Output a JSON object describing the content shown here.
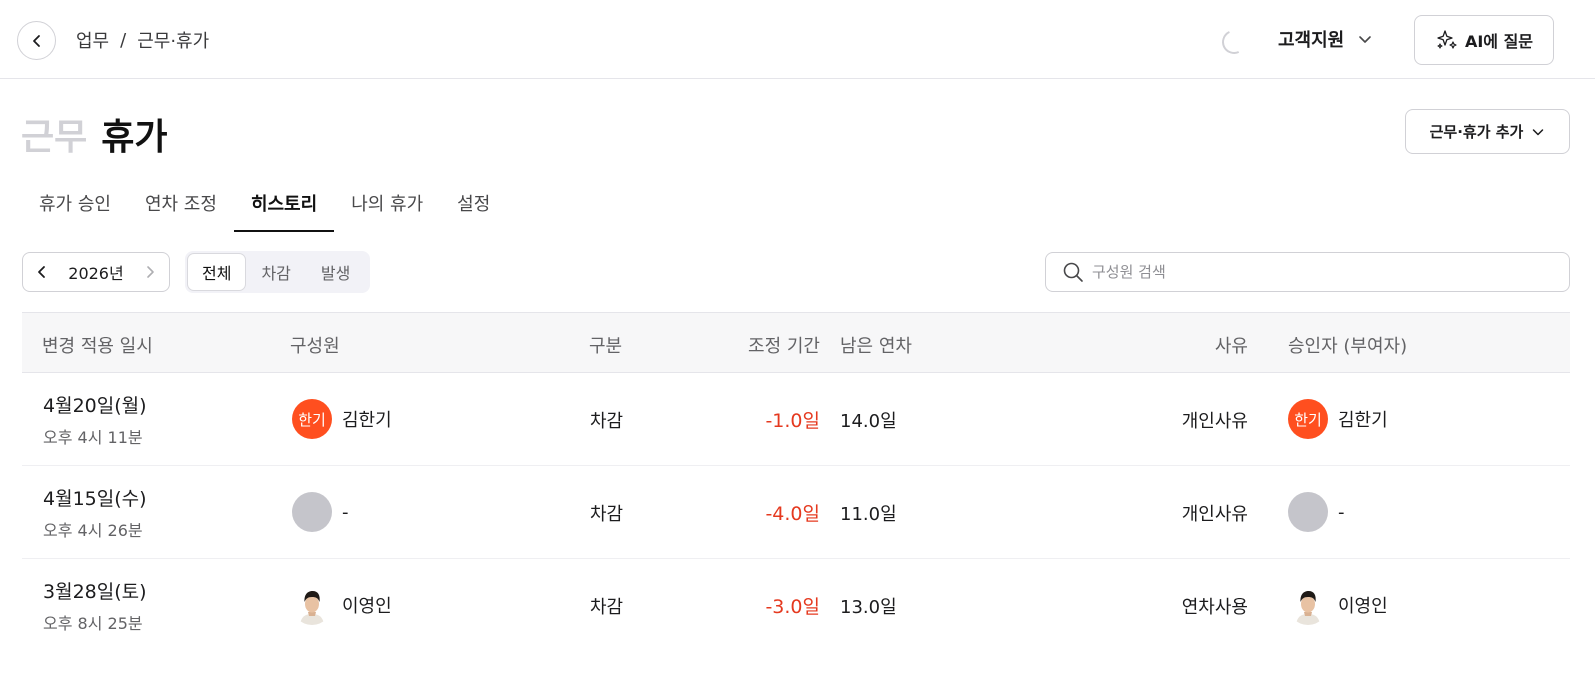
{
  "header": {
    "breadcrumb": [
      "업무",
      "근무·휴가"
    ],
    "breadcrumb_sep": "/",
    "workspace": "고객지원",
    "ai_button": "AI에 질문"
  },
  "page": {
    "title_inactive": "근무",
    "title_active": "휴가",
    "add_button": "근무·휴가 추가"
  },
  "tabs": [
    {
      "label": "휴가 승인",
      "active": false
    },
    {
      "label": "연차 조정",
      "active": false
    },
    {
      "label": "히스토리",
      "active": true
    },
    {
      "label": "나의 휴가",
      "active": false
    },
    {
      "label": "설정",
      "active": false
    }
  ],
  "filters": {
    "year": "2026년",
    "segments": [
      {
        "label": "전체",
        "active": true
      },
      {
        "label": "차감",
        "active": false
      },
      {
        "label": "발생",
        "active": false
      }
    ],
    "search_placeholder": "구성원 검색"
  },
  "table": {
    "columns": [
      "변경 적용 일시",
      "구성원",
      "구분",
      "조정 기간",
      "남은 연차",
      "사유",
      "승인자 (부여자)"
    ],
    "rows": [
      {
        "date": "4월20일(월)",
        "time": "오후 4시 11분",
        "member": {
          "name": "김한기",
          "avatar_text": "한기",
          "avatar": "orange"
        },
        "type": "차감",
        "adjust": "-1.0일",
        "remaining": "14.0일",
        "reason": "개인사유",
        "approver": {
          "name": "김한기",
          "avatar_text": "한기",
          "avatar": "orange"
        }
      },
      {
        "date": "4월15일(수)",
        "time": "오후 4시 26분",
        "member": {
          "name": "-",
          "avatar_text": "",
          "avatar": "gray"
        },
        "type": "차감",
        "adjust": "-4.0일",
        "remaining": "11.0일",
        "reason": "개인사유",
        "approver": {
          "name": "-",
          "avatar_text": "",
          "avatar": "gray"
        }
      },
      {
        "date": "3월28일(토)",
        "time": "오후 8시 25분",
        "member": {
          "name": "이영인",
          "avatar_text": "",
          "avatar": "photo"
        },
        "type": "차감",
        "adjust": "-3.0일",
        "remaining": "13.0일",
        "reason": "연차사용",
        "approver": {
          "name": "이영인",
          "avatar_text": "",
          "avatar": "photo"
        }
      }
    ]
  },
  "colors": {
    "accent_negative": "#e5391f",
    "avatar_orange": "#ff4f1f",
    "avatar_gray": "#c5c5cb"
  },
  "icons": [
    "chevron-left-icon",
    "loading-spinner-icon",
    "chevron-down-icon",
    "sparkle-icon",
    "chevron-right-icon",
    "search-icon"
  ]
}
